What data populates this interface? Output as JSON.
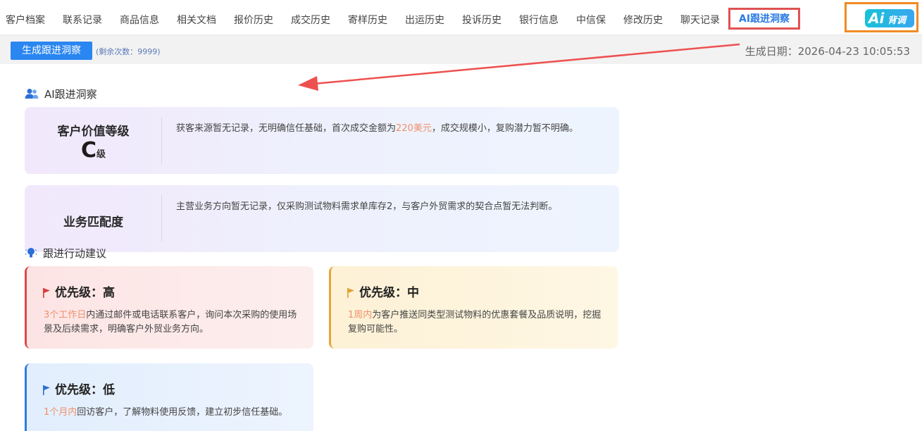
{
  "tabs": [
    {
      "label": "客户档案"
    },
    {
      "label": "联系记录"
    },
    {
      "label": "商品信息"
    },
    {
      "label": "相关文档"
    },
    {
      "label": "报价历史"
    },
    {
      "label": "成交历史"
    },
    {
      "label": "寄样历史"
    },
    {
      "label": "出运历史"
    },
    {
      "label": "投诉历史"
    },
    {
      "label": "银行信息"
    },
    {
      "label": "中信保"
    },
    {
      "label": "修改历史"
    },
    {
      "label": "聊天记录"
    },
    {
      "label": "AI跟进洞察",
      "active": true
    }
  ],
  "logo": {
    "ai": "Ai",
    "text": "背调"
  },
  "actionbar": {
    "generate_button": "生成跟进洞察",
    "remaining": "(剩余次数：9999)",
    "generated_date": "生成日期：2026-04-23 10:05:53"
  },
  "insight": {
    "section_title": "AI跟进洞察",
    "value_level": {
      "label": "客户价值等级",
      "grade": "C",
      "grade_suffix": "级",
      "desc_pre": "获客来源暂无记录，无明确信任基础，首次成交金额为",
      "desc_highlight": "220美元",
      "desc_post": "，成交规模小，复购潜力暂不明确。"
    },
    "business_match": {
      "label": "业务匹配度",
      "desc": "主营业务方向暂无记录，仅采购测试物料需求单库存2，与客户外贸需求的契合点暂无法判断。"
    }
  },
  "actions": {
    "section_title": "跟进行动建议",
    "items": [
      {
        "title": "优先级：高",
        "highlight": "3个工作日",
        "text": "内通过邮件或电话联系客户，询问本次采购的使用场景及后续需求，明确客户外贸业务方向。"
      },
      {
        "title": "优先级：中",
        "highlight": "1周内",
        "text": "为客户推送同类型测试物料的优惠套餐及品质说明，挖掘复购可能性。"
      },
      {
        "title": "优先级：低",
        "highlight": "1个月内",
        "text": "回访客户，了解物料使用反馈，建立初步信任基础。"
      }
    ]
  },
  "colors": {
    "accent": "#2a86f0",
    "annotation_red": "#e05252",
    "logo_border": "#f08a24",
    "highlight_text": "#f0906a",
    "priority_high": "#e04848",
    "priority_mid": "#e5a53a",
    "priority_low": "#2b7de0"
  },
  "icons": {
    "insight_section": "users-icon",
    "actions_section": "lightbulb-icon",
    "priority_flag": "flag-icon"
  }
}
